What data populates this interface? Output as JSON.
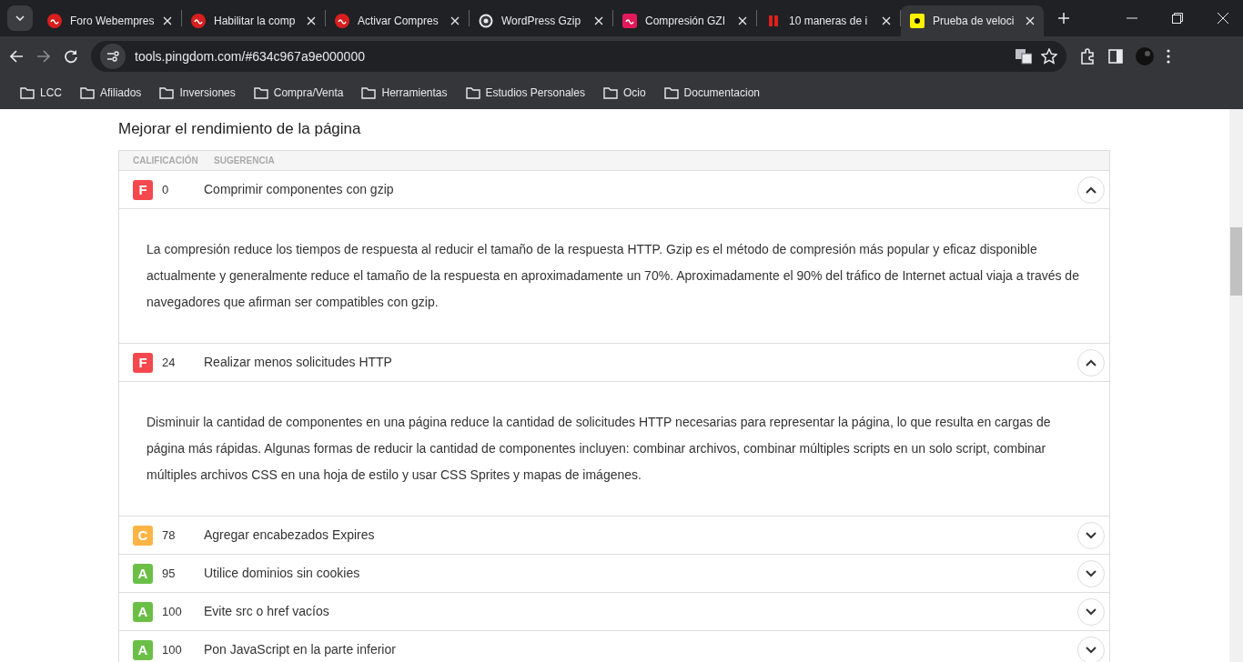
{
  "browser": {
    "tabs": [
      {
        "title": "Foro Webempres",
        "kind": "circle",
        "selected": false
      },
      {
        "title": "Habilitar la comp",
        "kind": "circle",
        "selected": false
      },
      {
        "title": "Activar Compres",
        "kind": "circle",
        "selected": false
      },
      {
        "title": "WordPress Gzip",
        "kind": "ring",
        "selected": false
      },
      {
        "title": "Compresión GZI",
        "kind": "square",
        "selected": false
      },
      {
        "title": "10 maneras de i",
        "kind": "bars",
        "selected": false
      },
      {
        "title": "Prueba de veloci",
        "kind": "tile",
        "selected": true
      }
    ],
    "address": "tools.pingdom.com/#634c967a9e000000",
    "bookmarks": [
      "LCC",
      "Afiliados",
      "Inversiones",
      "Compra/Venta",
      "Herramientas",
      "Estudios Personales",
      "Ocio",
      "Documentacion"
    ]
  },
  "section": {
    "title": "Mejorar el rendimiento de la página",
    "columns": [
      "CALIFICACIÓN",
      "SUGERENCIA"
    ],
    "rows": [
      {
        "grade": "F",
        "color": "#f5484e",
        "score": "0",
        "suggestion": "Comprimir componentes con gzip",
        "expanded": true,
        "description": "La compresión reduce los tiempos de respuesta al reducir el tamaño de la respuesta HTTP. Gzip es el método de compresión más popular y eficaz disponible actualmente y generalmente reduce el tamaño de la respuesta en aproximadamente un 70%. Aproximadamente el 90% del tráfico de Internet actual viaja a través de navegadores que afirman ser compatibles con gzip."
      },
      {
        "grade": "F",
        "color": "#f5484e",
        "score": "24",
        "suggestion": "Realizar menos solicitudes HTTP",
        "expanded": true,
        "description": "Disminuir la cantidad de componentes en una página reduce la cantidad de solicitudes HTTP necesarias para representar la página, lo que resulta en cargas de página más rápidas. Algunas formas de reducir la cantidad de componentes incluyen: combinar archivos, combinar múltiples scripts en un solo script, combinar múltiples archivos CSS en una hoja de estilo y usar CSS Sprites y mapas de imágenes."
      },
      {
        "grade": "C",
        "color": "#ffb444",
        "score": "78",
        "suggestion": "Agregar encabezados Expires",
        "expanded": false
      },
      {
        "grade": "A",
        "color": "#6bbf47",
        "score": "95",
        "suggestion": "Utilice dominios sin cookies",
        "expanded": false
      },
      {
        "grade": "A",
        "color": "#6bbf47",
        "score": "100",
        "suggestion": "Evite src o href vacíos",
        "expanded": false
      },
      {
        "grade": "A",
        "color": "#6bbf47",
        "score": "100",
        "suggestion": "Pon JavaScript en la parte inferior",
        "expanded": false
      }
    ]
  }
}
